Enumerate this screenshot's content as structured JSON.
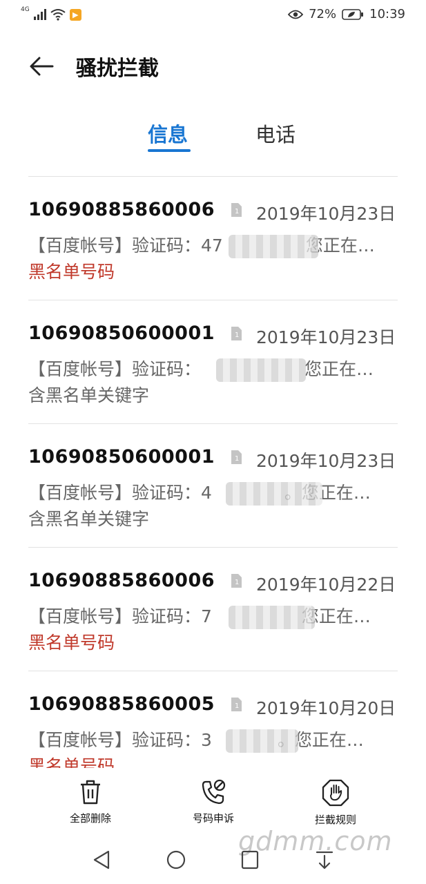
{
  "status": {
    "network": "4G",
    "battery": "72%",
    "time": "10:39"
  },
  "header": {
    "title": "骚扰拦截"
  },
  "tabs": [
    {
      "label": "信息",
      "active": true
    },
    {
      "label": "电话",
      "active": false
    }
  ],
  "messages": [
    {
      "number": "10690885860006",
      "date": "2019年10月23日",
      "preview_prefix": "【百度帐号】验证码：",
      "preview_visible": "47",
      "preview_suffix": "您正在…",
      "reason": "黑名单号码",
      "reason_color": "#c0392b"
    },
    {
      "number": "10690850600001",
      "date": "2019年10月23日",
      "preview_prefix": "【百度帐号】验证码：",
      "preview_visible": "",
      "preview_suffix": "您正在…",
      "reason": "含黑名单关键字",
      "reason_color": "#666666"
    },
    {
      "number": "10690850600001",
      "date": "2019年10月23日",
      "preview_prefix": "【百度帐号】验证码：",
      "preview_visible": "4",
      "preview_suffix": "。您正在…",
      "reason": "含黑名单关键字",
      "reason_color": "#666666"
    },
    {
      "number": "10690885860006",
      "date": "2019年10月22日",
      "preview_prefix": "【百度帐号】验证码：",
      "preview_visible": "7",
      "preview_suffix": "您正在…",
      "reason": "黑名单号码",
      "reason_color": "#c0392b"
    },
    {
      "number": "10690885860005",
      "date": "2019年10月20日",
      "preview_prefix": "【百度帐号】验证码：",
      "preview_visible": "3",
      "preview_suffix": "。您正在…",
      "reason": "黑名单号码",
      "reason_color": "#c0392b"
    }
  ],
  "actions": [
    {
      "label": "全部删除",
      "icon": "trash-icon"
    },
    {
      "label": "号码申诉",
      "icon": "phone-appeal-icon"
    },
    {
      "label": "拦截规则",
      "icon": "block-hand-icon"
    }
  ],
  "watermark": "gdmm.com",
  "colors": {
    "accent": "#1976d2",
    "warning": "#c0392b"
  }
}
